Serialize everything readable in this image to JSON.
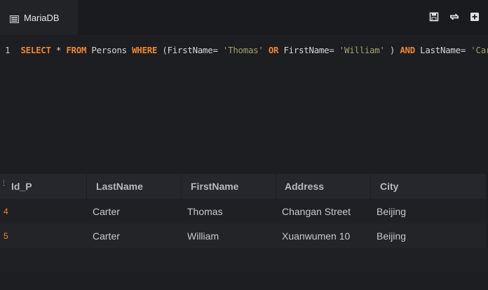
{
  "tab": {
    "label": "MariaDB",
    "icon": "database-icon"
  },
  "toolbar": {
    "buttons": [
      {
        "name": "save-button",
        "icon": "save-icon"
      },
      {
        "name": "swap-button",
        "icon": "swap-icon"
      },
      {
        "name": "add-button",
        "icon": "plus-square-icon"
      }
    ]
  },
  "editor": {
    "line_number": "1",
    "tokens": [
      {
        "t": "SELECT",
        "c": "kw"
      },
      {
        "t": " * ",
        "c": ""
      },
      {
        "t": "FROM",
        "c": "kw"
      },
      {
        "t": " Persons ",
        "c": ""
      },
      {
        "t": "WHERE",
        "c": "kw"
      },
      {
        "t": " (FirstName=",
        "c": ""
      },
      {
        "t": "'Thomas'",
        "c": "str"
      },
      {
        "t": " ",
        "c": ""
      },
      {
        "t": "OR",
        "c": "kw"
      },
      {
        "t": " FirstName=",
        "c": ""
      },
      {
        "t": "'William'",
        "c": "str"
      },
      {
        "t": ") ",
        "c": ""
      },
      {
        "t": "AND",
        "c": "kw"
      },
      {
        "t": " LastName=",
        "c": ""
      },
      {
        "t": "'Carter'",
        "c": "str"
      }
    ]
  },
  "results": {
    "columns": [
      "Id_P",
      "LastName",
      "FirstName",
      "Address",
      "City"
    ],
    "rows": [
      [
        "4",
        "Carter",
        "Thomas",
        "Changan Street",
        "Beijing"
      ],
      [
        "5",
        "Carter",
        "William",
        "Xuanwumen 10",
        "Beijing"
      ]
    ]
  },
  "colors": {
    "keyword": "#f0862f",
    "string": "#9fa06a",
    "background": "#1d1e22"
  }
}
